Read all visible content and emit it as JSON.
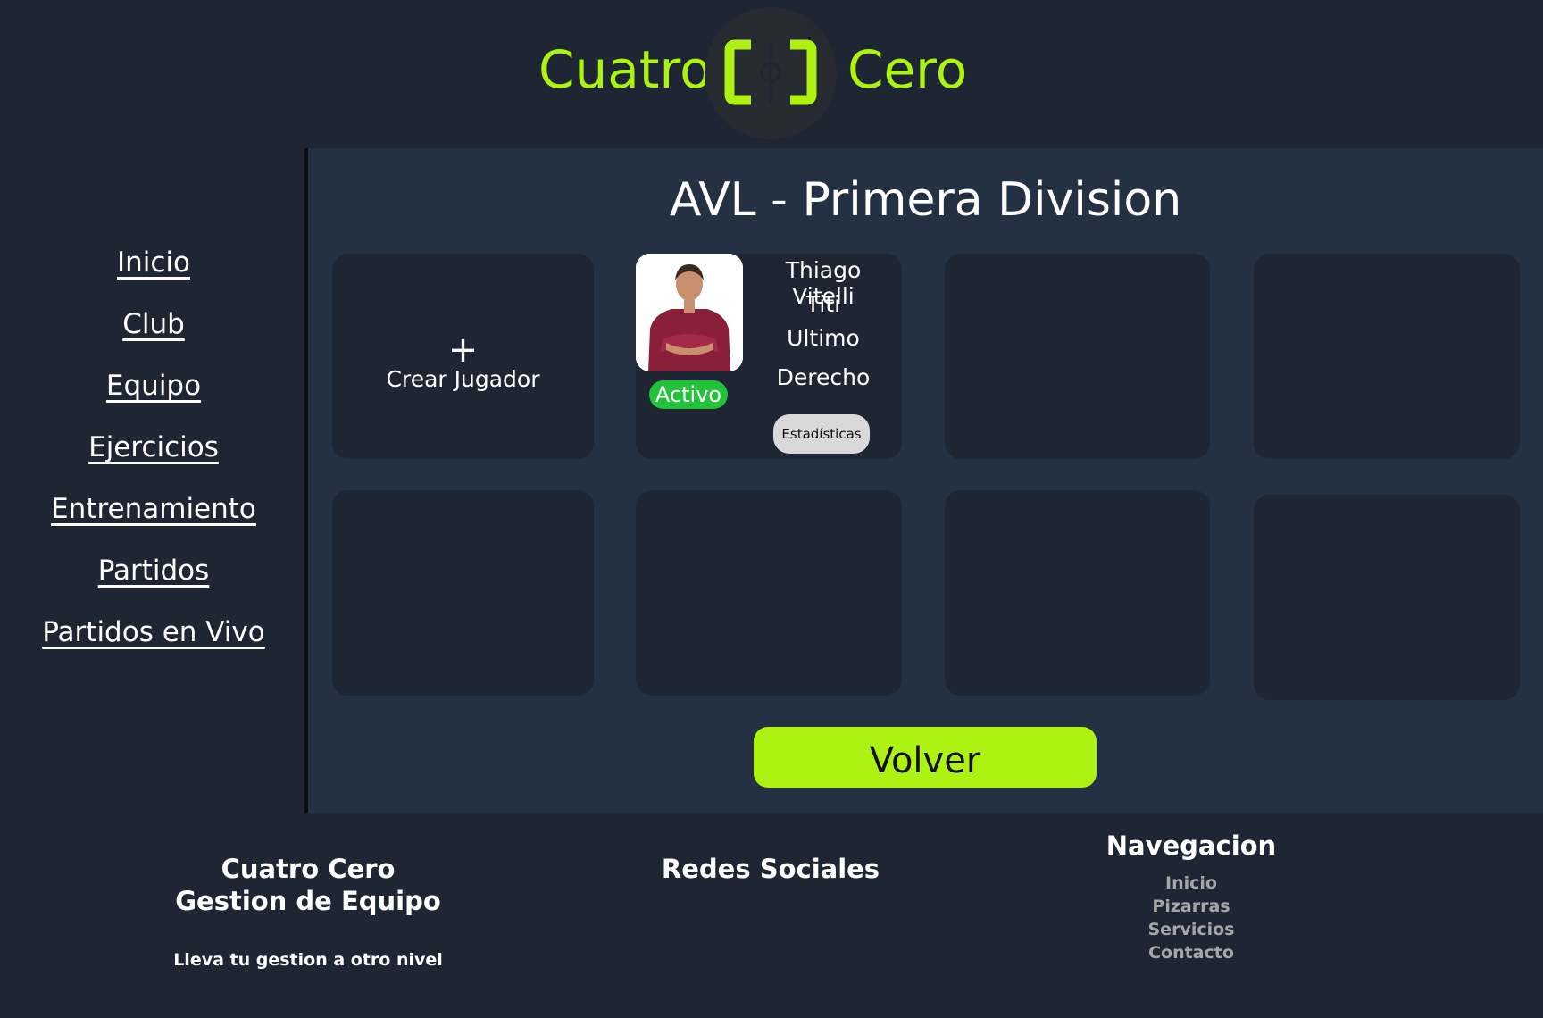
{
  "header": {
    "brand_left": "Cuatro",
    "brand_right": "Cero",
    "logo_icon": "bracket-circle-logo-icon",
    "accent_color": "#aef213"
  },
  "sidebar": {
    "items": [
      {
        "label": "Inicio"
      },
      {
        "label": "Club"
      },
      {
        "label": "Equipo"
      },
      {
        "label": "Ejercicios"
      },
      {
        "label": "Entrenamiento"
      },
      {
        "label": "Partidos"
      },
      {
        "label": "Partidos en Vivo"
      }
    ]
  },
  "main": {
    "title": "AVL - Primera Division",
    "create_card": {
      "icon": "plus-icon",
      "plus": "+",
      "label": "Crear Jugador"
    },
    "player": {
      "name": "Thiago Vitelli",
      "nickname": "Titi",
      "position": "Ultimo",
      "side": "Derecho",
      "status": "Activo",
      "status_color": "#22c33a",
      "stats_label": "Estadísticas"
    },
    "back_label": "Volver"
  },
  "footer": {
    "brand_line1": "Cuatro Cero",
    "brand_line2": "Gestion de Equipo",
    "tagline": "Lleva tu gestion a otro nivel",
    "social_title": "Redes Sociales",
    "nav_title": "Navegacion",
    "nav_links": [
      {
        "label": "Inicio"
      },
      {
        "label": "Pizarras"
      },
      {
        "label": "Servicios"
      },
      {
        "label": "Contacto"
      }
    ]
  }
}
